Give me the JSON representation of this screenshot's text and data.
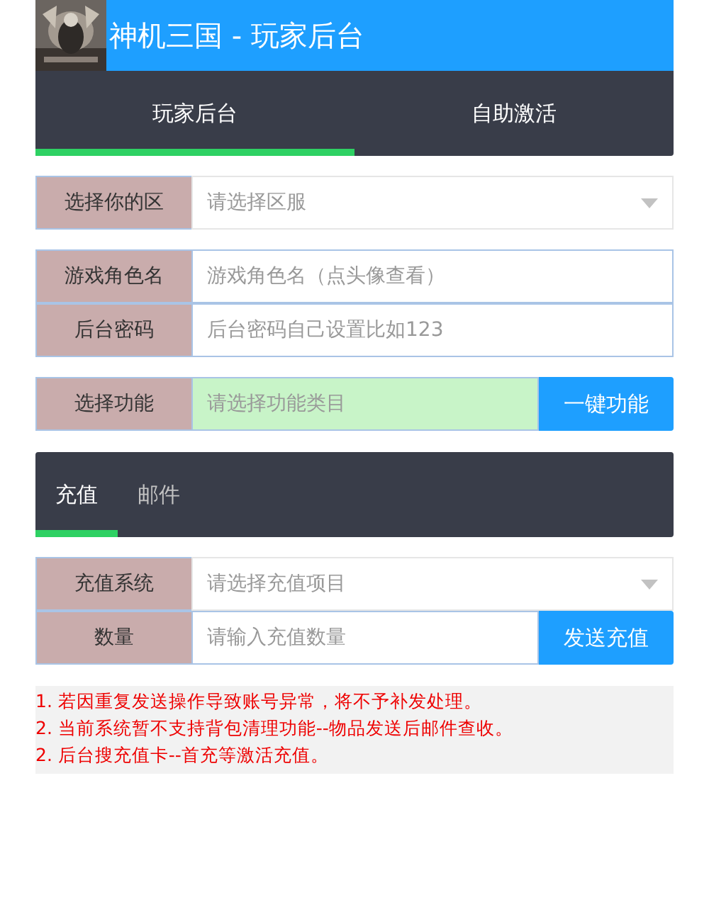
{
  "header": {
    "title": "神机三国 - 玩家后台"
  },
  "tabs": [
    {
      "label": "玩家后台",
      "selected": true
    },
    {
      "label": "自助激活",
      "selected": false
    }
  ],
  "form_groups": [
    [
      {
        "kind": "select",
        "label": "选择你的区",
        "placeholder": "请选择区服"
      }
    ],
    [
      {
        "kind": "input",
        "label": "游戏角色名",
        "placeholder": "游戏角色名（点头像查看）"
      },
      {
        "kind": "input",
        "label": "后台密码",
        "placeholder": "后台密码自己设置比如123"
      }
    ],
    [
      {
        "kind": "select-button",
        "label": "选择功能",
        "placeholder": "请选择功能类目",
        "button": "一键功能"
      }
    ]
  ],
  "sub_tabs": [
    {
      "label": "充值",
      "selected": true
    },
    {
      "label": "邮件",
      "selected": false
    }
  ],
  "recharge_groups": [
    [
      {
        "kind": "select",
        "label": "充值系统",
        "placeholder": "请选择充值项目"
      },
      {
        "kind": "input-button",
        "label": "数量",
        "placeholder": "请输入充值数量",
        "button": "发送充值"
      }
    ]
  ],
  "notes": [
    "1. 若因重复发送操作导致账号异常，将不予补发处理。",
    "2. 当前系统暂不支持背包清理功能--物品发送后邮件查收。",
    "2. 后台搜充值卡--首充等激活充值。"
  ]
}
